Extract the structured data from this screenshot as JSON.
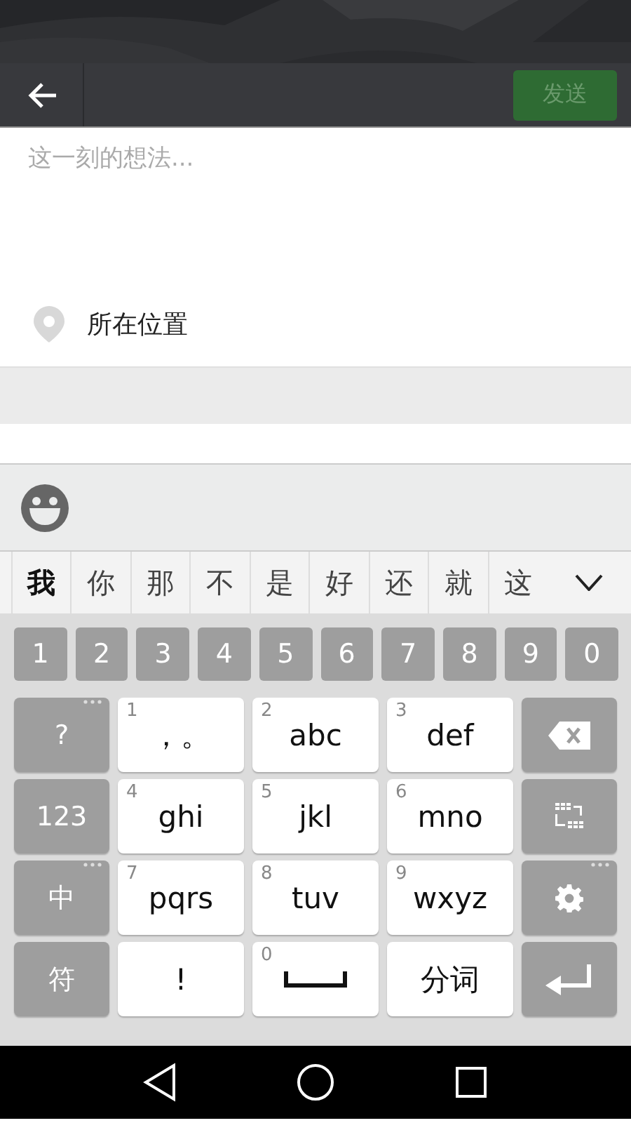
{
  "toolbar": {
    "send_button": {
      "label": "发送",
      "disabled": true
    }
  },
  "post": {
    "placeholder": "这一刻的想法..."
  },
  "location": {
    "label": "所在位置"
  },
  "candidates": [
    {
      "text": "我",
      "selected": true
    },
    {
      "text": "你",
      "selected": false
    },
    {
      "text": "那",
      "selected": false
    },
    {
      "text": "不",
      "selected": false
    },
    {
      "text": "是",
      "selected": false
    },
    {
      "text": "好",
      "selected": false
    },
    {
      "text": "还",
      "selected": false
    },
    {
      "text": "就",
      "selected": false
    },
    {
      "text": "这",
      "selected": false
    }
  ],
  "number_row": [
    "1",
    "2",
    "3",
    "4",
    "5",
    "6",
    "7",
    "8",
    "9",
    "0"
  ],
  "keys": [
    {
      "kind": "side",
      "label": "?",
      "more": true
    },
    {
      "kind": "letter",
      "digit": "1",
      "label": "，。"
    },
    {
      "kind": "letter",
      "digit": "2",
      "label": "abc"
    },
    {
      "kind": "letter",
      "digit": "3",
      "label": "def"
    },
    {
      "kind": "backspace",
      "more": false
    },
    {
      "kind": "side",
      "label": "123",
      "more": false
    },
    {
      "kind": "letter",
      "digit": "4",
      "label": "ghi"
    },
    {
      "kind": "letter",
      "digit": "5",
      "label": "jkl"
    },
    {
      "kind": "letter",
      "digit": "6",
      "label": "mno"
    },
    {
      "kind": "layout",
      "more": false
    },
    {
      "kind": "side",
      "label": "中",
      "more": true
    },
    {
      "kind": "letter",
      "digit": "7",
      "label": "pqrs"
    },
    {
      "kind": "letter",
      "digit": "8",
      "label": "tuv"
    },
    {
      "kind": "letter",
      "digit": "9",
      "label": "wxyz"
    },
    {
      "kind": "settings",
      "more": true
    },
    {
      "kind": "side",
      "label": "符",
      "more": false
    },
    {
      "kind": "letter",
      "label": "!"
    },
    {
      "kind": "space",
      "digit": "0"
    },
    {
      "kind": "letter",
      "label": "分词"
    },
    {
      "kind": "enter",
      "more": false
    }
  ]
}
